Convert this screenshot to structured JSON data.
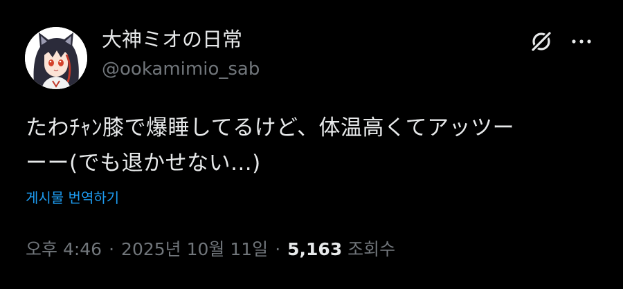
{
  "author": {
    "display_name": "大神ミオの日常",
    "handle": "@ookamimio_sab",
    "avatar_icon": "avatar-image"
  },
  "header_actions": {
    "grok_icon": "grok-icon",
    "more_icon": "more-icon"
  },
  "tweet": {
    "text_line_1": "たわﾁｬﾝ膝で爆睡してるけど、体温高くてアッツー",
    "text_line_2": "ーー(でも退かせない...)",
    "translate_label": "게시물 번역하기"
  },
  "meta": {
    "time": "오후 4:46",
    "separator_1": "·",
    "date": "2025년 10월 11일",
    "separator_2": "·",
    "views_count": "5,163",
    "views_label": "조회수"
  },
  "colors": {
    "background": "#000000",
    "primary_text": "#e7e9ea",
    "secondary_text": "#71767b",
    "link": "#1d9bf0"
  }
}
